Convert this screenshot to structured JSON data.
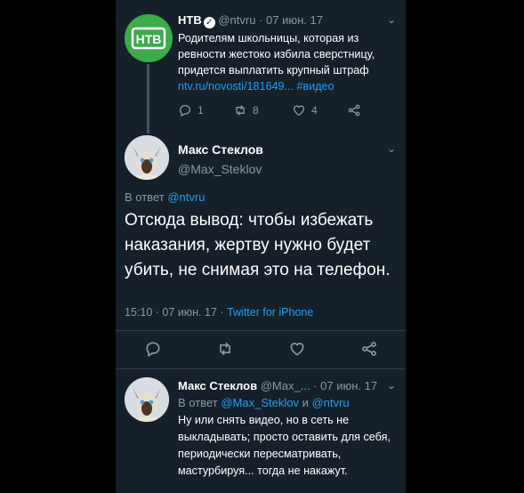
{
  "tweet1": {
    "name": "НТВ",
    "handle": "@ntvru",
    "sep": "·",
    "date": "07 июн. 17",
    "logo_text": "НТВ",
    "text": "Родителям школьницы, которая из ревности жестоко избила сверстницу, придется выплатить крупный штраф",
    "link": "ntv.ru/novosti/181649...",
    "hashtag": "#видео",
    "replies": "1",
    "retweets": "8",
    "likes": "4"
  },
  "tweet2": {
    "name": "Макс Стеклов",
    "handle": "@Max_Steklov",
    "reply_prefix": "В ответ",
    "reply_to": "@ntvru",
    "text": "Отсюда вывод: чтобы избежать наказания, жертву нужно будет убить, не снимая это на телефон.",
    "time": "15:10",
    "sep": "·",
    "date": "07 июн. 17",
    "sep2": "·",
    "source": "Twitter for iPhone"
  },
  "tweet3": {
    "name": "Макс Стеклов",
    "handle": "@Max_...",
    "sep": "·",
    "date": "07 июн. 17",
    "reply_prefix": "В ответ",
    "reply_to_1": "@Max_Steklov",
    "reply_and": "и",
    "reply_to_2": "@ntvru",
    "text": "Ну или снять видео, но в сеть не выкладывать; просто оставить для себя, периодически пересматривать, мастурбируя... тогда не накажут."
  },
  "colors": {
    "background": "#15202b",
    "accent": "#1da1f2",
    "muted": "#8899a6",
    "ntv_green": "#3cab4b"
  }
}
